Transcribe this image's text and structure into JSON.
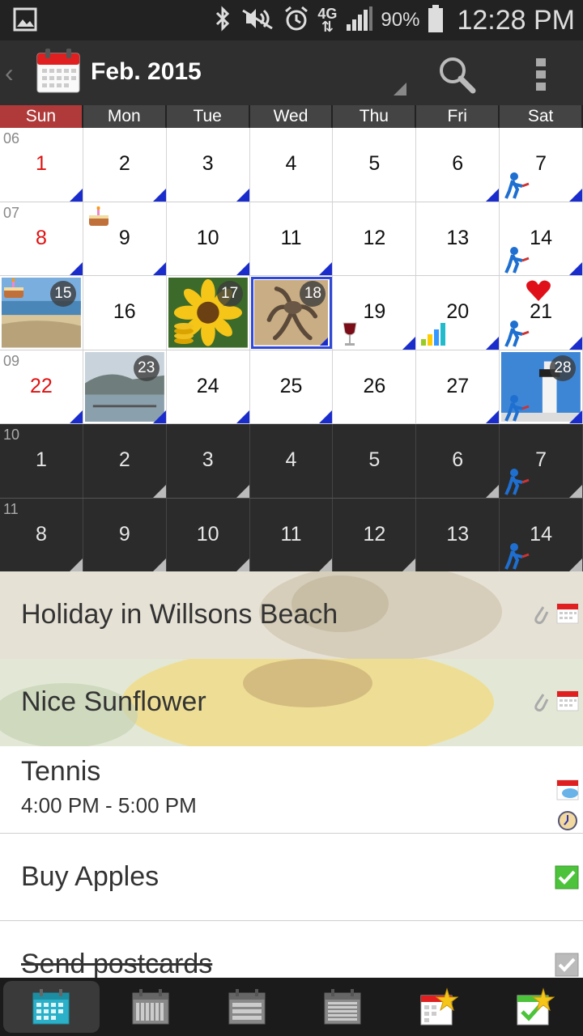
{
  "status": {
    "battery": "90%",
    "time": "12:28 PM",
    "network": "4G"
  },
  "header": {
    "title": "Feb. 2015"
  },
  "weekdays": [
    "Sun",
    "Mon",
    "Tue",
    "Wed",
    "Thu",
    "Fri",
    "Sat"
  ],
  "weeks": [
    {
      "wk": "06",
      "days": [
        "1",
        "2",
        "3",
        "4",
        "5",
        "6",
        "7"
      ]
    },
    {
      "wk": "07",
      "days": [
        "8",
        "9",
        "10",
        "11",
        "12",
        "13",
        "14"
      ]
    },
    {
      "wk": "",
      "days": [
        "15",
        "16",
        "17",
        "18",
        "19",
        "20",
        "21"
      ]
    },
    {
      "wk": "09",
      "days": [
        "22",
        "23",
        "24",
        "25",
        "26",
        "27",
        "28"
      ]
    },
    {
      "wk": "10",
      "days": [
        "1",
        "2",
        "3",
        "4",
        "5",
        "6",
        "7"
      ]
    },
    {
      "wk": "11",
      "days": [
        "8",
        "9",
        "10",
        "11",
        "12",
        "13",
        "14"
      ]
    }
  ],
  "events": [
    {
      "title": "Holiday in Willsons Beach"
    },
    {
      "title": "Nice Sunflower"
    },
    {
      "title": "Tennis",
      "time": "4:00 PM - 5:00 PM"
    },
    {
      "title": "Buy Apples"
    },
    {
      "title": "Send postcards"
    }
  ],
  "colors": {
    "accent": "#1a2dcc",
    "sunday": "#b03a3a",
    "holiday_red": "#e01010"
  },
  "nav_icons": [
    "month-view-icon",
    "week-view-icon",
    "day-view-icon",
    "agenda-view-icon",
    "tasks-icon",
    "completed-tasks-icon"
  ]
}
